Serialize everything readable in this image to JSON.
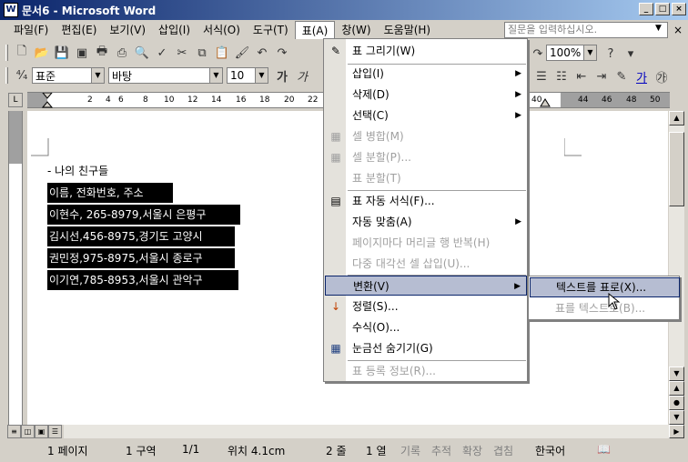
{
  "window": {
    "title": "문서6 - Microsoft Word",
    "app_icon": "W",
    "buttons": [
      "_",
      "□",
      "×"
    ]
  },
  "menubar": {
    "items": [
      {
        "label": "파일(F)"
      },
      {
        "label": "편집(E)"
      },
      {
        "label": "보기(V)"
      },
      {
        "label": "삽입(I)"
      },
      {
        "label": "서식(O)"
      },
      {
        "label": "도구(T)"
      },
      {
        "label": "표(A)"
      },
      {
        "label": "창(W)"
      },
      {
        "label": "도움말(H)"
      }
    ],
    "help_placeholder": "질문을 입력하십시오.",
    "close": "×"
  },
  "toolbar": {
    "style_value": "표준",
    "font_value": "바탕",
    "size_value": "10",
    "zoom_value": "100%"
  },
  "ruler": {
    "numbers": [
      "2",
      "4",
      "6",
      "8",
      "10",
      "12",
      "14",
      "16",
      "18",
      "20",
      "22",
      "40",
      "44",
      "46",
      "48",
      "50"
    ]
  },
  "document": {
    "heading": "- 나의 친구들",
    "lines": [
      "이름, 전화번호, 주소",
      "이현수, 265-8979,서울시 은평구",
      "김시선,456-8975,경기도 고양시",
      "권민정,975-8975,서울시 종로구",
      "이기연,785-8953,서울시 관악구"
    ]
  },
  "table_menu": {
    "items": [
      {
        "label": "표 그리기(W)",
        "icon": "pencil-icon",
        "glyph": "✎",
        "disabled": false,
        "submenu": false
      },
      {
        "label": "삽입(I)",
        "disabled": false,
        "submenu": true
      },
      {
        "label": "삭제(D)",
        "disabled": false,
        "submenu": true
      },
      {
        "label": "선택(C)",
        "disabled": false,
        "submenu": true
      },
      {
        "label": "셀 병합(M)",
        "icon": "merge-cells-icon",
        "glyph": "▦",
        "disabled": true,
        "submenu": false
      },
      {
        "label": "셀 분할(P)...",
        "icon": "split-cells-icon",
        "glyph": "▦",
        "disabled": true,
        "submenu": false
      },
      {
        "label": "표 분할(T)",
        "disabled": true,
        "submenu": false
      },
      {
        "label": "표 자동 서식(F)...",
        "icon": "autoformat-icon",
        "glyph": "▤",
        "disabled": false,
        "submenu": false
      },
      {
        "label": "자동 맞춤(A)",
        "disabled": false,
        "submenu": true
      },
      {
        "label": "페이지마다 머리글 행 반복(H)",
        "disabled": true,
        "submenu": false
      },
      {
        "label": "다중 대각선 셀 삽입(U)...",
        "disabled": true,
        "submenu": false
      },
      {
        "label": "변환(V)",
        "disabled": false,
        "submenu": true,
        "highlight": true
      },
      {
        "label": "정렬(S)...",
        "icon": "sort-icon",
        "glyph": "↓",
        "disabled": false,
        "submenu": false
      },
      {
        "label": "수식(O)...",
        "disabled": false,
        "submenu": false
      },
      {
        "label": "눈금선 숨기기(G)",
        "icon": "gridlines-icon",
        "glyph": "▦",
        "disabled": false,
        "submenu": false
      },
      {
        "label": "표 등록 정보(R)...",
        "disabled": true,
        "submenu": false
      }
    ]
  },
  "convert_submenu": {
    "items": [
      {
        "label": "텍스트를 표로(X)...",
        "highlight": true
      },
      {
        "label": "표를 텍스트로(B)...",
        "disabled": true
      }
    ]
  },
  "statusbar": {
    "page": "1 페이지",
    "section": "1 구역",
    "page_count": "1/1",
    "position": "위치 4.1cm",
    "line": "2 줄",
    "column": "1 열",
    "rec": "기록",
    "trk": "추적",
    "ext": "확장",
    "ovr": "겹침",
    "language": "한국어"
  }
}
